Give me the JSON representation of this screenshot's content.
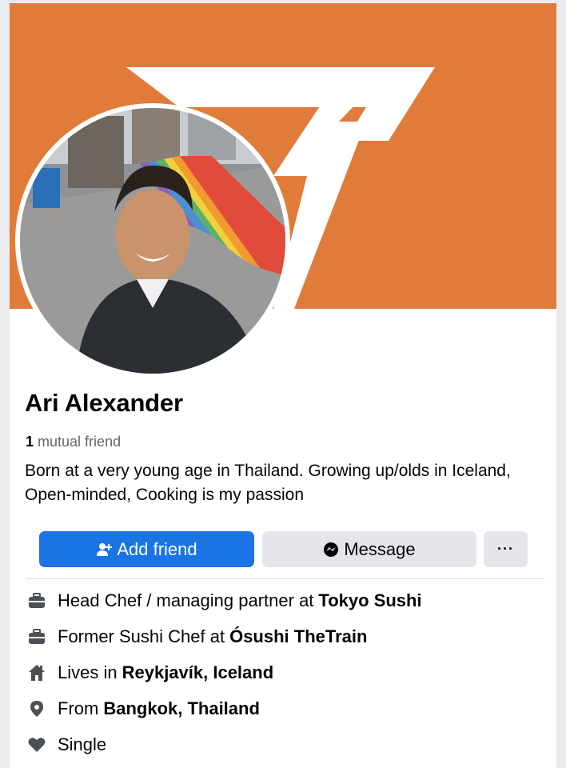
{
  "colors": {
    "cover_orange": "#e07b39",
    "primary_blue": "#1b74e4",
    "secondary_gray": "#e4e6eb",
    "muted_text": "#65676b",
    "icon_gray": "#4b4f56"
  },
  "profile": {
    "name": "Ari Alexander",
    "mutual_count": "1",
    "mutual_label": "mutual friend",
    "bio": "Born at a very young age in Thailand. Growing up/olds in Iceland, Open-minded, Cooking is my passion"
  },
  "actions": {
    "add_friend": "Add friend",
    "message": "Message",
    "more": "···"
  },
  "details": [
    {
      "icon": "briefcase-icon",
      "text": "Head Chef / managing partner at",
      "bold": "Tokyo Sushi"
    },
    {
      "icon": "briefcase-icon",
      "text": "Former Sushi Chef at",
      "bold": "Ósushi TheTrain"
    },
    {
      "icon": "home-icon",
      "text": "Lives in",
      "bold": "Reykjavík, Iceland"
    },
    {
      "icon": "location-pin-icon",
      "text": "From",
      "bold": "Bangkok, Thailand"
    },
    {
      "icon": "heart-icon",
      "text": "Single",
      "bold": ""
    }
  ]
}
